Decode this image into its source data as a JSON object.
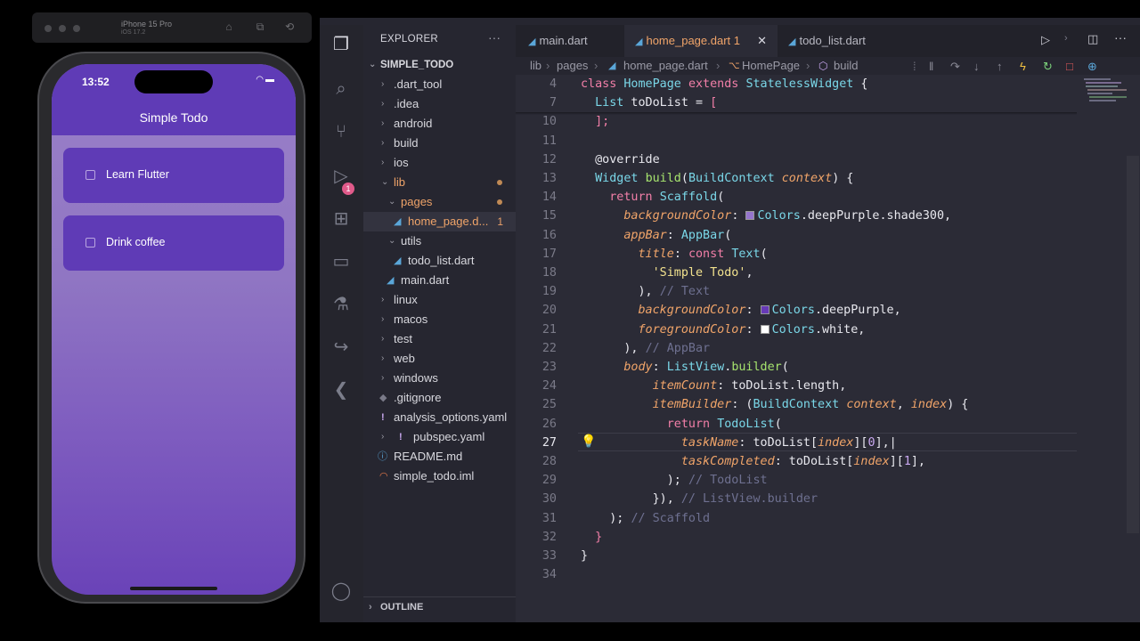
{
  "simulator": {
    "device": "iPhone 15 Pro",
    "os": "iOS 17.2",
    "status_time": "13:52",
    "app_title": "Simple Todo",
    "todos": [
      {
        "label": "Learn Flutter",
        "checked": false
      },
      {
        "label": "Drink coffee",
        "checked": false
      }
    ]
  },
  "vscode": {
    "explorer_title": "EXPLORER",
    "project": "SIMPLE_TODO",
    "tree": [
      {
        "label": ".dart_tool"
      },
      {
        "label": ".idea"
      },
      {
        "label": "android"
      },
      {
        "label": "build"
      },
      {
        "label": "ios"
      },
      {
        "label": "lib"
      },
      {
        "label": "pages"
      },
      {
        "label": "home_page.d...",
        "badge": "1"
      },
      {
        "label": "utils"
      },
      {
        "label": "todo_list.dart"
      },
      {
        "label": "main.dart"
      },
      {
        "label": "linux"
      },
      {
        "label": "macos"
      },
      {
        "label": "test"
      },
      {
        "label": "web"
      },
      {
        "label": "windows"
      },
      {
        "label": ".gitignore"
      },
      {
        "label": "analysis_options.yaml"
      },
      {
        "label": "pubspec.yaml"
      },
      {
        "label": "README.md"
      },
      {
        "label": "simple_todo.iml"
      }
    ],
    "outline_label": "OUTLINE",
    "tabs": [
      {
        "label": "main.dart"
      },
      {
        "label": "home_page.dart",
        "badge": "1",
        "active": true
      },
      {
        "label": "todo_list.dart"
      }
    ],
    "breadcrumb": [
      "lib",
      "pages",
      "home_page.dart",
      "HomePage",
      "build"
    ],
    "activity_badge": "1",
    "colors": {
      "accent": "#f0a469",
      "keyword": "#f27fa8",
      "type": "#7ad7e8",
      "function": "#a6e36e",
      "comment": "#6e7090"
    },
    "line_numbers": [
      "4",
      "7",
      "10",
      "11",
      "12",
      "13",
      "14",
      "15",
      "16",
      "17",
      "18",
      "19",
      "20",
      "21",
      "22",
      "23",
      "24",
      "25",
      "26",
      "27",
      "28",
      "29",
      "30",
      "31",
      "32",
      "33",
      "34"
    ],
    "current_line": "27"
  }
}
